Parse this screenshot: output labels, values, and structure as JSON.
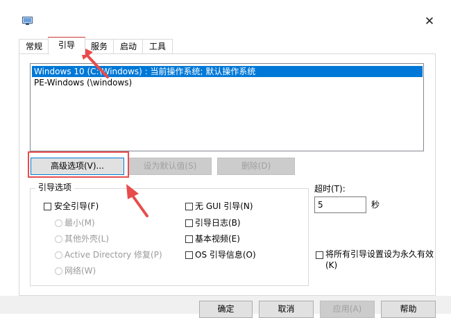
{
  "tabs": [
    {
      "label": "常规"
    },
    {
      "label": "引导"
    },
    {
      "label": "服务"
    },
    {
      "label": "启动"
    },
    {
      "label": "工具"
    }
  ],
  "os_list": [
    {
      "label": "Windows 10 (C:\\Windows) : 当前操作系统; 默认操作系统",
      "selected": true
    },
    {
      "label": "PE-Windows (\\windows)",
      "selected": false
    }
  ],
  "buttons": {
    "advanced": "高级选项(V)...",
    "set_default": "设为默认值(S)",
    "delete": "删除(D)"
  },
  "boot_options": {
    "legend": "引导选项",
    "safe_boot": "安全引导(F)",
    "minimal": "最小(M)",
    "alternate_shell": "其他外壳(L)",
    "active_directory": "Active Directory 修复(P)",
    "network": "网络(W)",
    "no_gui": "无 GUI 引导(N)",
    "boot_log": "引导日志(B)",
    "base_video": "基本视频(E)",
    "os_info": "OS 引导信息(O)"
  },
  "timeout": {
    "label": "超时(T):",
    "value": "5",
    "unit": "秒"
  },
  "permanent": {
    "line1": "将所有引导设置设为永久有效",
    "line2": "(K)"
  },
  "footer": {
    "ok": "确定",
    "cancel": "取消",
    "apply": "应用(A)",
    "help": "帮助"
  },
  "colors": {
    "selection": "#0078d7",
    "annotation": "#e74c4c"
  }
}
